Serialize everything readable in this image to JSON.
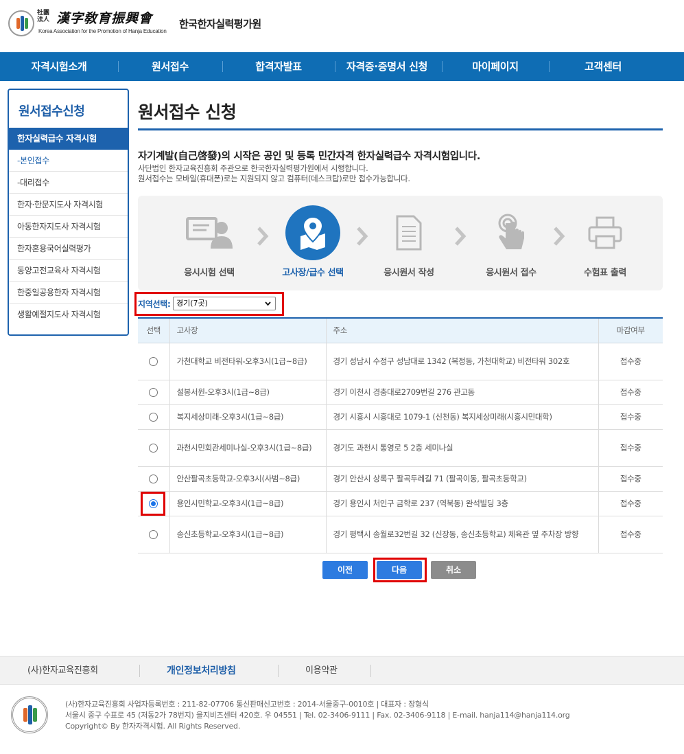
{
  "header": {
    "logo_hanja_small": "社團法人",
    "logo_hanja": "漢字敎育振興會",
    "logo_en": "Korea Association for the Promotion of Hanja Education",
    "logo_kr": "한국한자실력평가원"
  },
  "nav": {
    "items": [
      "자격시험소개",
      "원서접수",
      "합격자발표",
      "자격증·증명서 신청",
      "마이페이지",
      "고객센터"
    ]
  },
  "sidebar": {
    "title": "원서접수신청",
    "active_item": "한자실력급수 자격시험",
    "items": [
      "-본인접수",
      "-대리접수",
      "한자·한문지도사 자격시험",
      "아동한자지도사 자격시험",
      "한자혼용국어실력평가",
      "동양고전교육사 자격시험",
      "한중일공용한자 자격시험",
      "생활예절지도사 자격시험"
    ]
  },
  "main": {
    "title": "원서접수 신청",
    "intro_1": "자기계발(自己啓發)의 시작은 공인 및 등록 민간자격 한자실력급수 자격시험입니다.",
    "intro_2": "사단법인 한자교육진흥회 주관으로 한국한자실력평가원에서 시행합니다.",
    "intro_3": "원서접수는 모바일(휴대폰)로는 지원되지 않고 컴퓨터(데스크탑)로만 접수가능합니다."
  },
  "steps": [
    {
      "label": "응시시험 선택",
      "icon": "monitor-person-icon",
      "active": false
    },
    {
      "label": "고사장/급수 선택",
      "icon": "map-pin-icon",
      "active": true
    },
    {
      "label": "응시원서 작성",
      "icon": "document-icon",
      "active": false
    },
    {
      "label": "응시원서 접수",
      "icon": "touch-hand-icon",
      "active": false
    },
    {
      "label": "수험표 출력",
      "icon": "printer-icon",
      "active": false
    }
  ],
  "region": {
    "label": "지역선택:",
    "selected": "경기(7곳)"
  },
  "table": {
    "headers": {
      "select": "선택",
      "venue": "고사장",
      "address": "주소",
      "deadline": "마감여부"
    },
    "rows": [
      {
        "venue": "가천대학교 비전타워-오후3시(1급~8급)",
        "address": "경기 성남시 수정구 성남대로 1342 (복정동, 가천대학교) 비전타워 302호",
        "status": "접수중",
        "selected": false
      },
      {
        "venue": "설봉서원-오후3시(1급~8급)",
        "address": "경기 이천시 경충대로2709번길 276 관고동",
        "status": "접수중",
        "selected": false
      },
      {
        "venue": "복지세상미래-오후3시(1급~8급)",
        "address": "경기 시흥시 시흥대로 1079-1 (신천동) 복지세상미래(시흥시민대학)",
        "status": "접수중",
        "selected": false
      },
      {
        "venue": "과천시민회관세미나실-오후3시(1급~8급)",
        "address": "경기도 과천시 통영로 5 2층 세미나실",
        "status": "접수중",
        "selected": false
      },
      {
        "venue": "안산팔곡초등학교-오후3시(사범~8급)",
        "address": "경기 안산시 상록구 팔곡두레길 71 (팔곡이동, 팔곡초등학교)",
        "status": "접수중",
        "selected": false
      },
      {
        "venue": "용인시민학교-오후3시(1급~8급)",
        "address": "경기 용인시 처인구 금학로 237 (역북동) 완석빌딩 3층",
        "status": "접수중",
        "selected": true
      },
      {
        "venue": "송신초등학교-오후3시(1급~8급)",
        "address": "경기 평택시 송월로32번길 32 (신장동, 송신초등학교) 체육관 옆 주차장 방향",
        "status": "접수중",
        "selected": false
      }
    ]
  },
  "buttons": {
    "prev": "이전",
    "next": "다음",
    "cancel": "취소"
  },
  "footer": {
    "links": [
      "(사)한자교육진흥회",
      "개인정보처리방침",
      "이용약관"
    ],
    "line_1": "(사)한자교육진흥회     사업자등록번호 : 211-82-07706     통신판매신고번호 : 2014-서울중구-0010호 | 대표자 : 장형식",
    "line_2": "서울시 중구 수표로 45 (저동2가 78번지) 을지비즈센터 420호. 우 04551 | Tel. 02-3406-9111 | Fax. 02-3406-9118 | E-mail. hanja114@hanja114.org",
    "line_3": "Copyright© By 한자자격시험. All Rights Reserved."
  },
  "colors": {
    "brand_blue": "#0f6db4",
    "highlight_red": "#e00000",
    "button_blue": "#2d7be0",
    "button_gray": "#8c8c8c"
  }
}
